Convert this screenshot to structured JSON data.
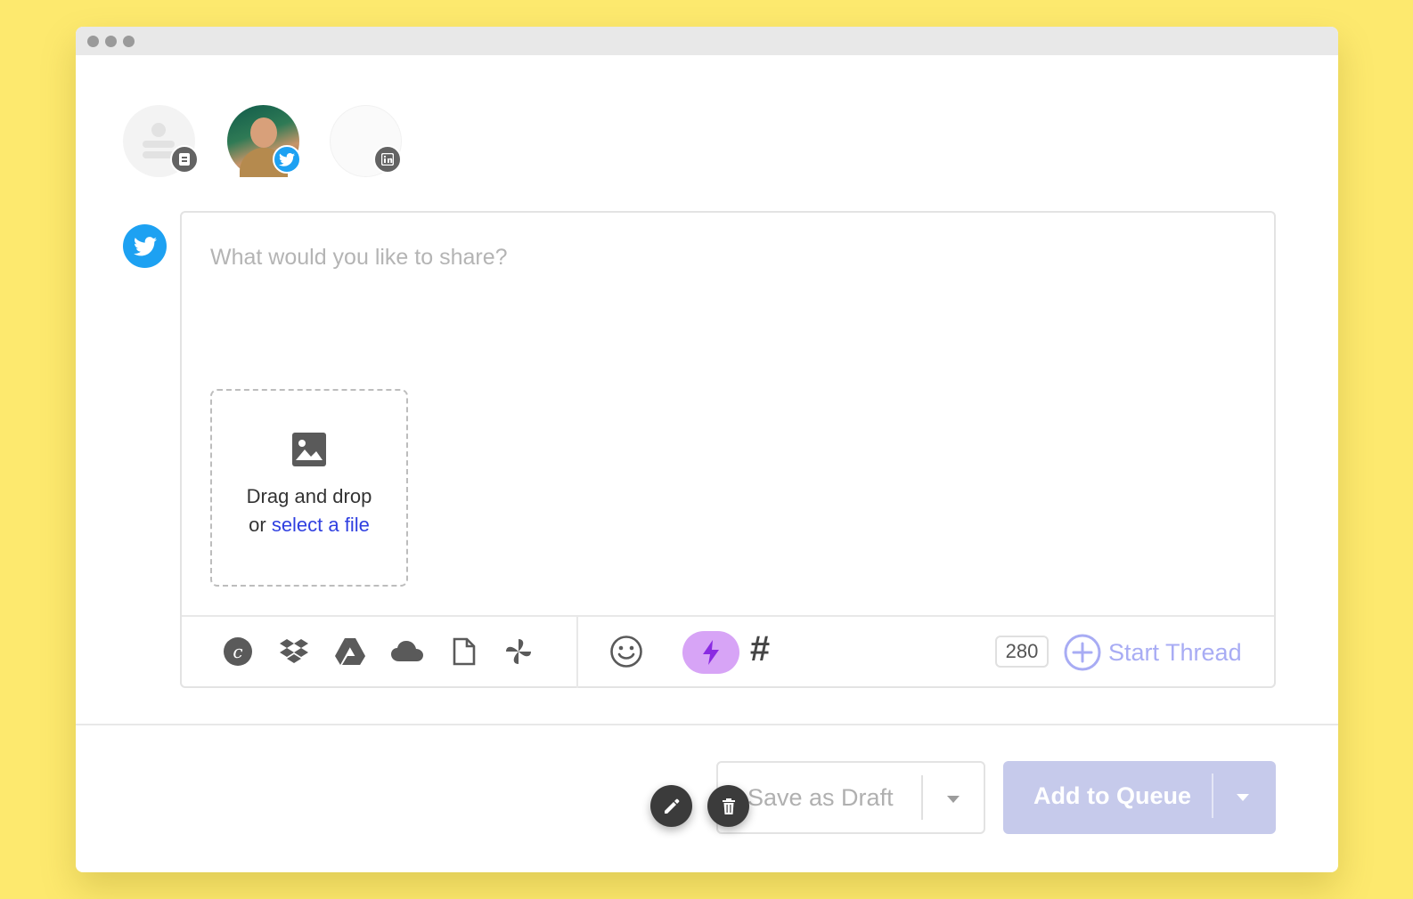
{
  "window": {
    "dots": 3
  },
  "profiles": [
    {
      "name": "profile-placeholder",
      "network_icon": "notebook-icon"
    },
    {
      "name": "profile-twitter",
      "network_icon": "twitter-icon"
    },
    {
      "name": "profile-linkedin",
      "network_icon": "linkedin-icon"
    }
  ],
  "composer": {
    "network_icon": "twitter-icon",
    "placeholder": "What would you like to share?",
    "dropzone": {
      "icon": "image-icon",
      "line1": "Drag and drop",
      "line2_prefix": "or ",
      "link_label": "select a file"
    },
    "toolbar": {
      "media_icons": [
        "canva-icon",
        "dropbox-icon",
        "google-drive-icon",
        "cloud-icon",
        "file-icon",
        "pinwheel-icon"
      ],
      "emoji_icon": "smiley-icon",
      "ai_icon": "lightning-icon",
      "hashtag_label": "#",
      "char_count": "280",
      "start_thread_label": "Start Thread"
    }
  },
  "footer": {
    "save_draft_label": "Save as Draft",
    "add_queue_label": "Add to Queue",
    "edit_icon": "pencil-icon",
    "delete_icon": "trash-icon"
  },
  "colors": {
    "background": "#fde96e",
    "twitter": "#1da1f2",
    "link": "#2f3fe0",
    "ai_pill": "#d7a4f6",
    "thread": "#a8acf4",
    "queue_button": "#c6caeb"
  }
}
